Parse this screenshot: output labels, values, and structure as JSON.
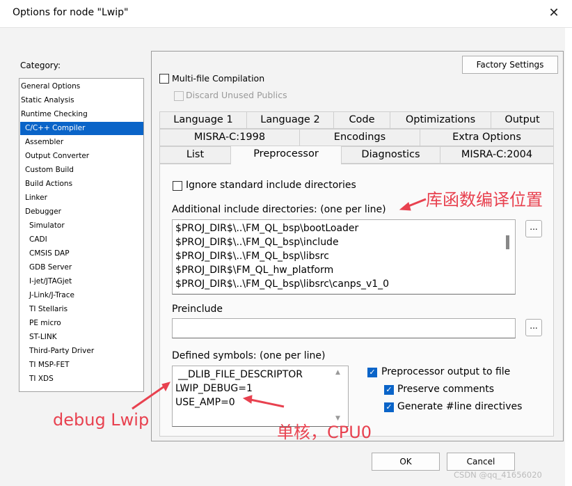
{
  "window": {
    "title": "Options for node \"Lwip\""
  },
  "category": {
    "label": "Category:",
    "items": [
      "General Options",
      "Static Analysis",
      "Runtime Checking",
      "C/C++ Compiler",
      "Assembler",
      "Output Converter",
      "Custom Build",
      "Build Actions",
      "Linker",
      "Debugger",
      "Simulator",
      "CADI",
      "CMSIS DAP",
      "GDB Server",
      "I-jet/JTAGjet",
      "J-Link/J-Trace",
      "TI Stellaris",
      "PE micro",
      "ST-LINK",
      "Third-Party Driver",
      "TI MSP-FET",
      "TI XDS"
    ],
    "selected_index": 3
  },
  "panel": {
    "factory_settings": "Factory Settings",
    "multifile": "Multi-file Compilation",
    "discard": "Discard Unused Publics"
  },
  "tabs": {
    "row1": [
      "Language 1",
      "Language 2",
      "Code",
      "Optimizations",
      "Output"
    ],
    "row2": [
      "MISRA-C:1998",
      "Encodings",
      "Extra Options"
    ],
    "row3": [
      "List",
      "Preprocessor",
      "Diagnostics",
      "MISRA-C:2004"
    ],
    "active": "Preprocessor"
  },
  "preprocessor": {
    "ignore_std": "Ignore standard include directories",
    "include_label": "Additional include directories: (one per line)",
    "include_dirs": [
      "$PROJ_DIR$\\..\\FM_QL_bsp\\bootLoader",
      "$PROJ_DIR$\\..\\FM_QL_bsp\\include",
      "$PROJ_DIR$\\..\\FM_QL_bsp\\libsrc",
      "$PROJ_DIR$\\FM_QL_hw_platform",
      "$PROJ_DIR$\\..\\FM_QL_bsp\\libsrc\\canps_v1_0"
    ],
    "browse": "...",
    "preinclude_label": "Preinclude",
    "preinclude_value": "",
    "symbols_label": "Defined symbols: (one per line)",
    "symbols": [
      "__DLIB_FILE_DESCRIPTOR",
      "LWIP_DEBUG=1",
      "USE_AMP=0"
    ],
    "pp_output": "Preprocessor output to file",
    "preserve_comments": "Preserve comments",
    "gen_line": "Generate #line directives"
  },
  "buttons": {
    "ok": "OK",
    "cancel": "Cancel"
  },
  "annotations": {
    "include_note": "库函数编译位置",
    "debug_note": "debug Lwip",
    "core_note": "单核，CPU0",
    "color": "#e8414f"
  },
  "watermark": "CSDN @qq_41656020"
}
